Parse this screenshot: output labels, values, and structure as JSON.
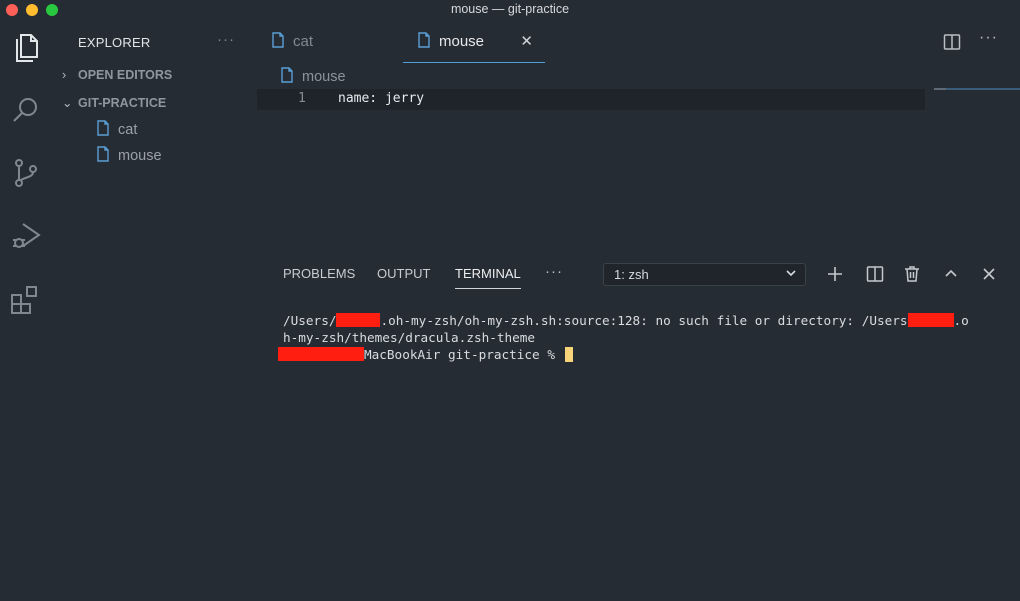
{
  "window": {
    "title": "mouse — git-practice"
  },
  "sidebar": {
    "title": "EXPLORER",
    "more": "···",
    "sections": [
      {
        "label": "OPEN EDITORS",
        "chevron": "›"
      },
      {
        "label": "GIT-PRACTICE",
        "chevron": "⌄"
      }
    ],
    "files": [
      "cat",
      "mouse"
    ]
  },
  "tabs": [
    {
      "label": "cat"
    },
    {
      "label": "mouse",
      "close": "✕"
    }
  ],
  "tab_actions": {
    "more": "···"
  },
  "breadcrumb": "mouse",
  "editor": {
    "line_number": "1",
    "code": "name: jerry"
  },
  "panel": {
    "tabs": [
      "PROBLEMS",
      "OUTPUT",
      "TERMINAL"
    ],
    "more": "···",
    "terminal_select": "1: zsh"
  },
  "terminal": {
    "line1_a": "/Users/",
    "line1_b": ".oh-my-zsh/oh-my-zsh.sh:source:128: no such file or directory: /Users",
    "line1_c": ".o",
    "line2": "h-my-zsh/themes/dracula.zsh-theme",
    "line3": "MacBookAir git-practice % "
  },
  "colors": {
    "background": "#262c33",
    "accent": "#4f9fd6",
    "redaction": "#ff1e0f",
    "cursor": "#f7d37a"
  }
}
